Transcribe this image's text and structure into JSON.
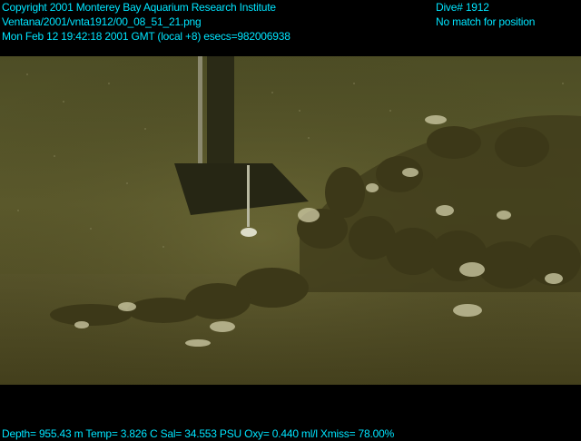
{
  "header": {
    "copyright": "Copyright 2001 Monterey Bay Aquarium Research Institute",
    "filepath": "Ventana/2001/vnta1912/00_08_51_21.png",
    "timestamp": "Mon Feb 12 19:42:18 2001 GMT (local +8)  esecs=982006938",
    "dive": "Dive# 1912",
    "position_status": "No match for position"
  },
  "footer": {
    "telemetry": "Depth= 955.43 m  Temp= 3.826 C  Sal= 34.553 PSU  Oxy= 0.440 ml/l  Xmiss= 78.00%"
  },
  "scene": {
    "water_color": "#5a5a2c",
    "seafloor_color": "#47431f",
    "overlay_text_color": "#00e5ff"
  }
}
